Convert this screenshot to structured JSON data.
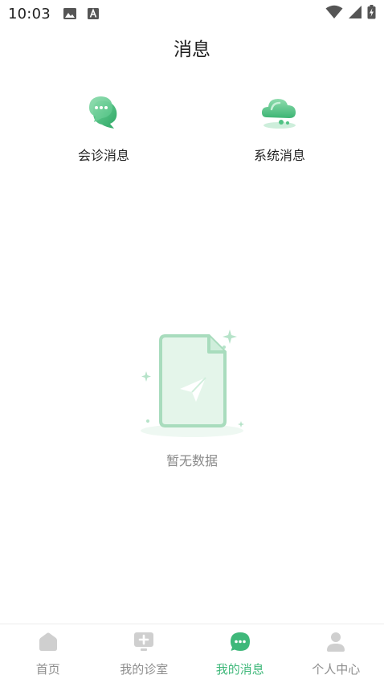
{
  "status_bar": {
    "time": "10:03"
  },
  "header": {
    "title": "消息"
  },
  "categories": [
    {
      "label": "会诊消息",
      "icon": "chat-bubbles-icon"
    },
    {
      "label": "系统消息",
      "icon": "cloud-icon"
    }
  ],
  "empty_state": {
    "text": "暂无数据",
    "icon": "empty-document-icon"
  },
  "tabs": [
    {
      "label": "首页",
      "icon": "home-icon",
      "active": false
    },
    {
      "label": "我的诊室",
      "icon": "clinic-icon",
      "active": false
    },
    {
      "label": "我的消息",
      "icon": "message-icon",
      "active": true
    },
    {
      "label": "个人中心",
      "icon": "user-icon",
      "active": false
    }
  ],
  "colors": {
    "accent": "#3fb87a",
    "inactive": "#c9c9c9",
    "text_muted": "#8a8a8a"
  }
}
